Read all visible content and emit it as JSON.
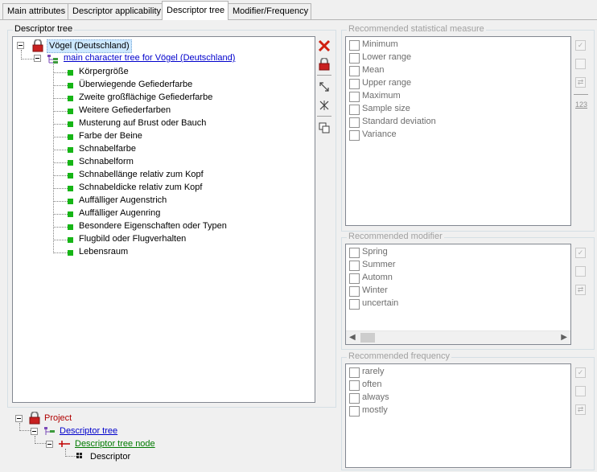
{
  "tabs": [
    {
      "label": "Main attributes",
      "active": false
    },
    {
      "label": "Descriptor applicability",
      "active": false
    },
    {
      "label": "Descriptor tree",
      "active": true
    },
    {
      "label": "Modifier/Frequency",
      "active": false
    }
  ],
  "descriptor_tree": {
    "title": "Descriptor tree",
    "root_label": "Vögel (Deutschland)",
    "tree_label": "main character tree for Vögel (Deutschland)",
    "items": [
      "Körpergröße",
      "Überwiegende Gefiederfarbe",
      "Zweite großflächige Gefiederfarbe",
      "Weitere Gefiederfarben",
      "Musterung auf Brust oder Bauch",
      "Farbe der Beine",
      "Schnabelfarbe",
      "Schnabelform",
      "Schnabellänge relativ zum Kopf",
      "Schnabeldicke relativ zum Kopf",
      "Auffälliger Augenstrich",
      "Auffälliger Augenring",
      "Besondere Eigenschaften oder Typen",
      "Flugbild oder Flugverhalten",
      "Lebensraum"
    ],
    "toolbar": [
      "delete-icon",
      "lock-icon",
      "expand-icon",
      "collapse-icon",
      "copy-icon"
    ]
  },
  "legend": {
    "project": "Project",
    "tree": "Descriptor tree",
    "node": "Descriptor tree node",
    "descriptor": "Descriptor"
  },
  "statistical_measure": {
    "title": "Recommended statistical measure",
    "options": [
      "Minimum",
      "Lower range",
      "Mean",
      "Upper range",
      "Maximum",
      "Sample size",
      "Standard deviation",
      "Variance"
    ],
    "side_label": "123"
  },
  "modifier": {
    "title": "Recommended modifier",
    "options": [
      "Spring",
      "Summer",
      "Automn",
      "Winter",
      "uncertain"
    ]
  },
  "frequency": {
    "title": "Recommended frequency",
    "options": [
      "rarely",
      "often",
      "always",
      "mostly"
    ]
  },
  "colors": {
    "selection": "#cce8ff",
    "link_blue": "#0000cc",
    "node_green": "#16b516",
    "project_red": "#b00000",
    "disabled_text": "#6d6d6d"
  }
}
